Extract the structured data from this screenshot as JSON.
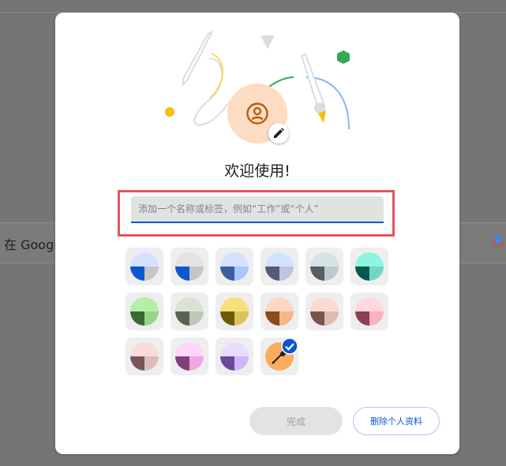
{
  "background": {
    "search_text": "在 Googl",
    "mic_icon": "microphone-icon"
  },
  "dialog": {
    "title": "欢迎使用!",
    "name_input": {
      "value": "",
      "placeholder": "添加一个名称或标签，例如“工作”或“个人”"
    },
    "avatar_icon": "account-circle-icon",
    "edit_icon": "pencil-icon",
    "selected_theme": "custom",
    "themes": [
      {
        "id": "default-blue",
        "top": "#d3e3fd",
        "left": "#0b57d0",
        "right": "#c4c7c5"
      },
      {
        "id": "grey",
        "top": "#e3e3e3",
        "left": "#0b57d0",
        "right": "#c4c7c5"
      },
      {
        "id": "blue",
        "top": "#d3e3fd",
        "left": "#3f5e9d",
        "right": "#a8c7fa"
      },
      {
        "id": "slate",
        "top": "#d3e3fd",
        "left": "#545b77",
        "right": "#bcc5de"
      },
      {
        "id": "cool-grey",
        "top": "#d5e3e6",
        "left": "#565e61",
        "right": "#bcc9cc"
      },
      {
        "id": "aqua",
        "top": "#8ff4e4",
        "left": "#005a4d",
        "right": "#6fd7c8"
      },
      {
        "id": "green",
        "top": "#b4efa5",
        "left": "#3a6a33",
        "right": "#98d58a"
      },
      {
        "id": "olive",
        "top": "#dbe2d3",
        "left": "#5a6153",
        "right": "#bfc7b8"
      },
      {
        "id": "yellow",
        "top": "#f7df7c",
        "left": "#6b5b05",
        "right": "#dcc25c"
      },
      {
        "id": "orange",
        "top": "#fdd7c2",
        "left": "#8a4a1d",
        "right": "#f5b58a"
      },
      {
        "id": "peach",
        "top": "#f9dccf",
        "left": "#775549",
        "right": "#dcbcb0"
      },
      {
        "id": "rose",
        "top": "#ffd9dd",
        "left": "#8b3f52",
        "right": "#fab1bd"
      },
      {
        "id": "pink-grey",
        "top": "#f9dbdc",
        "left": "#775657",
        "right": "#dcbcbd"
      },
      {
        "id": "magenta",
        "top": "#ffd6f7",
        "left": "#833f79",
        "right": "#f0a7e1"
      },
      {
        "id": "purple",
        "top": "#e9ddff",
        "left": "#6a4a9c",
        "right": "#cdb6fb"
      },
      {
        "id": "custom",
        "top": "#f9ad5d",
        "left": "#f9ad5d",
        "right": "#f9ad5d",
        "icon": "eyedropper-icon",
        "selected": true
      }
    ],
    "check_icon": "check-circle-icon",
    "done_label": "完成",
    "delete_label": "删除个人资料",
    "colors": {
      "accent": "#0b57d0",
      "highlight_border": "#e5545a",
      "avatar_bg": "#fcdcc2",
      "avatar_fg": "#b75c12"
    }
  }
}
